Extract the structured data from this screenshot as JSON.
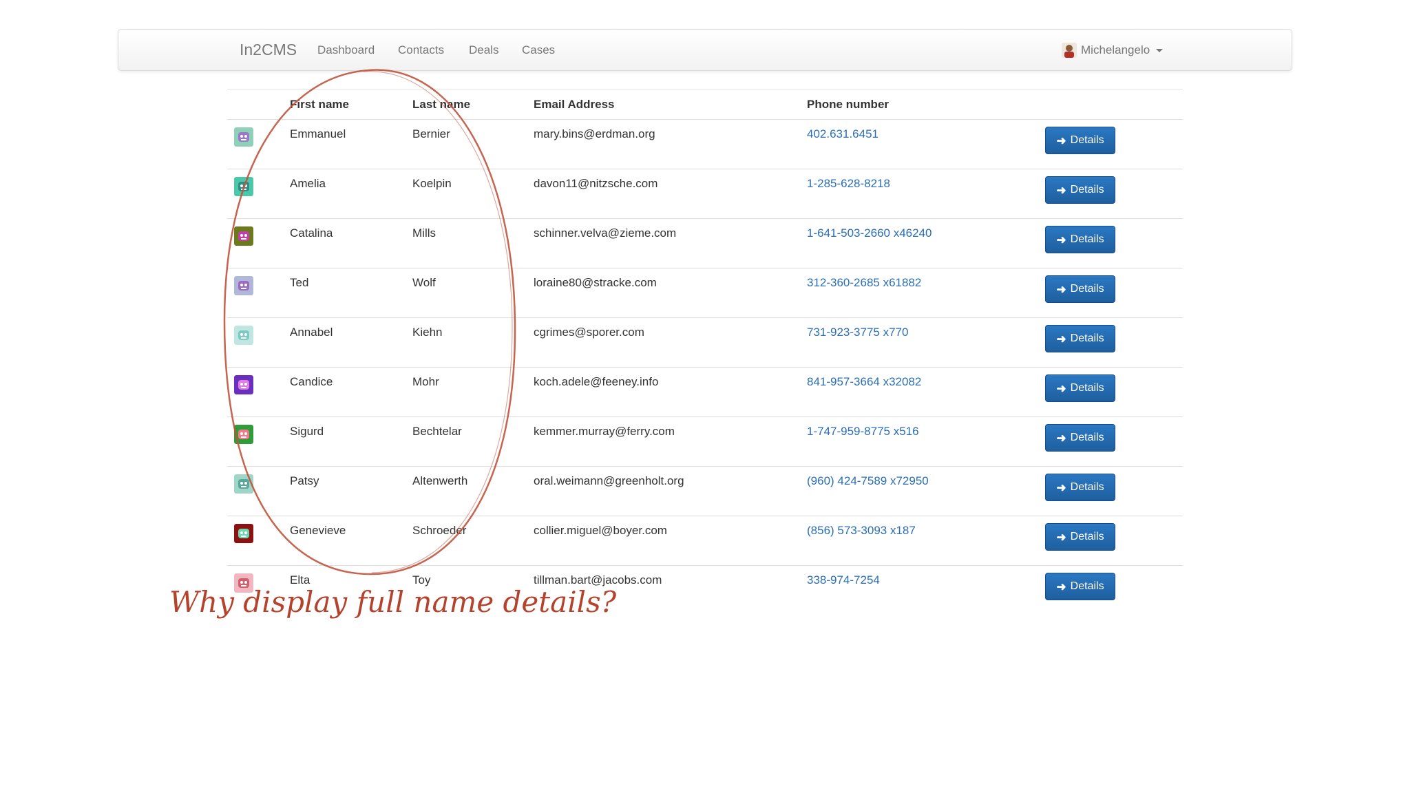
{
  "navbar": {
    "brand": "In2CMS",
    "links": [
      "Dashboard",
      "Contacts",
      "Deals",
      "Cases"
    ],
    "user": "Michelangelo"
  },
  "table": {
    "headers": {
      "first_name": "First name",
      "last_name": "Last name",
      "email": "Email Address",
      "phone": "Phone number"
    },
    "button_label": "Details",
    "rows": [
      {
        "first": "Emmanuel",
        "last": "Bernier",
        "email": "mary.bins@erdman.org",
        "phone": "402.631.6451"
      },
      {
        "first": "Amelia",
        "last": "Koelpin",
        "email": "davon11@nitzsche.com",
        "phone": "1-285-628-8218"
      },
      {
        "first": "Catalina",
        "last": "Mills",
        "email": "schinner.velva@zieme.com",
        "phone": "1-641-503-2660 x46240"
      },
      {
        "first": "Ted",
        "last": "Wolf",
        "email": "loraine80@stracke.com",
        "phone": "312-360-2685 x61882"
      },
      {
        "first": "Annabel",
        "last": "Kiehn",
        "email": "cgrimes@sporer.com",
        "phone": "731-923-3775 x770"
      },
      {
        "first": "Candice",
        "last": "Mohr",
        "email": "koch.adele@feeney.info",
        "phone": "841-957-3664 x32082"
      },
      {
        "first": "Sigurd",
        "last": "Bechtelar",
        "email": "kemmer.murray@ferry.com",
        "phone": "1-747-959-8775 x516"
      },
      {
        "first": "Patsy",
        "last": "Altenwerth",
        "email": "oral.weimann@greenholt.org",
        "phone": "(960) 424-7589 x72950"
      },
      {
        "first": "Genevieve",
        "last": "Schroeder",
        "email": "collier.miguel@boyer.com",
        "phone": "(856) 573-3093 x187"
      },
      {
        "first": "Elta",
        "last": "Toy",
        "email": "tillman.bart@jacobs.com",
        "phone": "338-974-7254"
      }
    ]
  },
  "avatars": [
    {
      "icon": "robot-avatar-icon",
      "bg": "#8fd0b8",
      "fg": "#9a7ac8"
    },
    {
      "icon": "robot-avatar-icon",
      "bg": "#4cc7a8",
      "fg": "#2f8d8a"
    },
    {
      "icon": "robot-avatar-icon",
      "bg": "#6b7a1a",
      "fg": "#c23ea8"
    },
    {
      "icon": "robot-avatar-icon",
      "bg": "#b0b7d8",
      "fg": "#9a6cc0"
    },
    {
      "icon": "robot-avatar-icon",
      "bg": "#bfe6e0",
      "fg": "#7fc9c4"
    },
    {
      "icon": "robot-avatar-icon",
      "bg": "#6a2fbf",
      "fg": "#e07ee6"
    },
    {
      "icon": "robot-avatar-icon",
      "bg": "#2f9c3a",
      "fg": "#f07b8a"
    },
    {
      "icon": "robot-avatar-icon",
      "bg": "#9fd6c8",
      "fg": "#5aa89a"
    },
    {
      "icon": "robot-avatar-icon",
      "bg": "#8c1212",
      "fg": "#6fd6b0"
    },
    {
      "icon": "robot-avatar-icon",
      "bg": "#f2b6c0",
      "fg": "#d0606e"
    }
  ],
  "annotation": {
    "text": "Why display full name details?",
    "color": "#b4432e"
  },
  "colors": {
    "button": "#1f64a8",
    "link": "#2a6eb4"
  }
}
